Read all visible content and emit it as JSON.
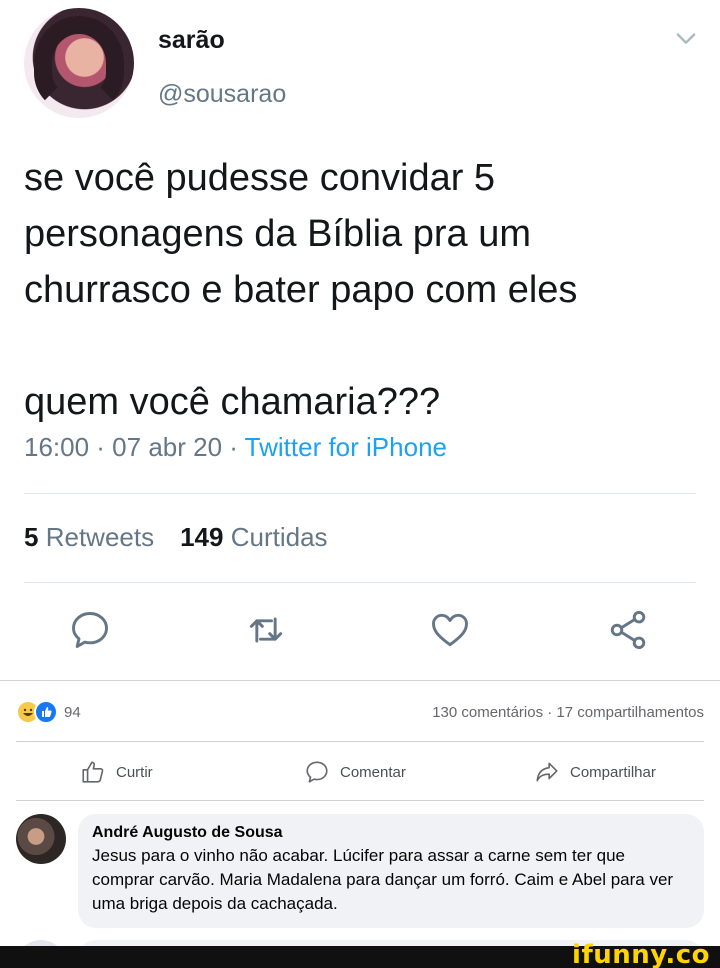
{
  "tweet": {
    "display_name": "sarão",
    "handle": "@sousarao",
    "text_part1": "se você pudesse convidar 5 personagens da Bíblia pra um churrasco e bater papo com eles",
    "text_part2": "quem você chamaria???",
    "meta_prefix": "16:00 · 07 abr 20 · ",
    "source": "Twitter for iPhone",
    "retweets_count": "5",
    "retweets_label": "Retweets",
    "likes_count": "149",
    "likes_label": "Curtidas",
    "icons": [
      "reply-icon",
      "retweet-icon",
      "like-icon",
      "share-icon",
      "chevron-down-icon"
    ]
  },
  "facebook": {
    "reaction_count": "94",
    "counts_text": "130 comentários · 17 compartilhamentos",
    "actions": {
      "like": "Curtir",
      "comment": "Comentar",
      "share": "Compartilhar"
    },
    "comment": {
      "author": "André Augusto de Sousa",
      "body": "Jesus para o vinho não acabar. Lúcifer para assar a carne sem ter que comprar carvão. Maria Madalena para dançar um forró. Caim e Abel para ver uma briga depois da cachaçada."
    },
    "colors": {
      "like_blue": "#1877f2",
      "haha_yellow": "#f7c949",
      "twitter_blue": "#1da1f2"
    }
  },
  "watermark": {
    "text": "ifunny.co"
  }
}
